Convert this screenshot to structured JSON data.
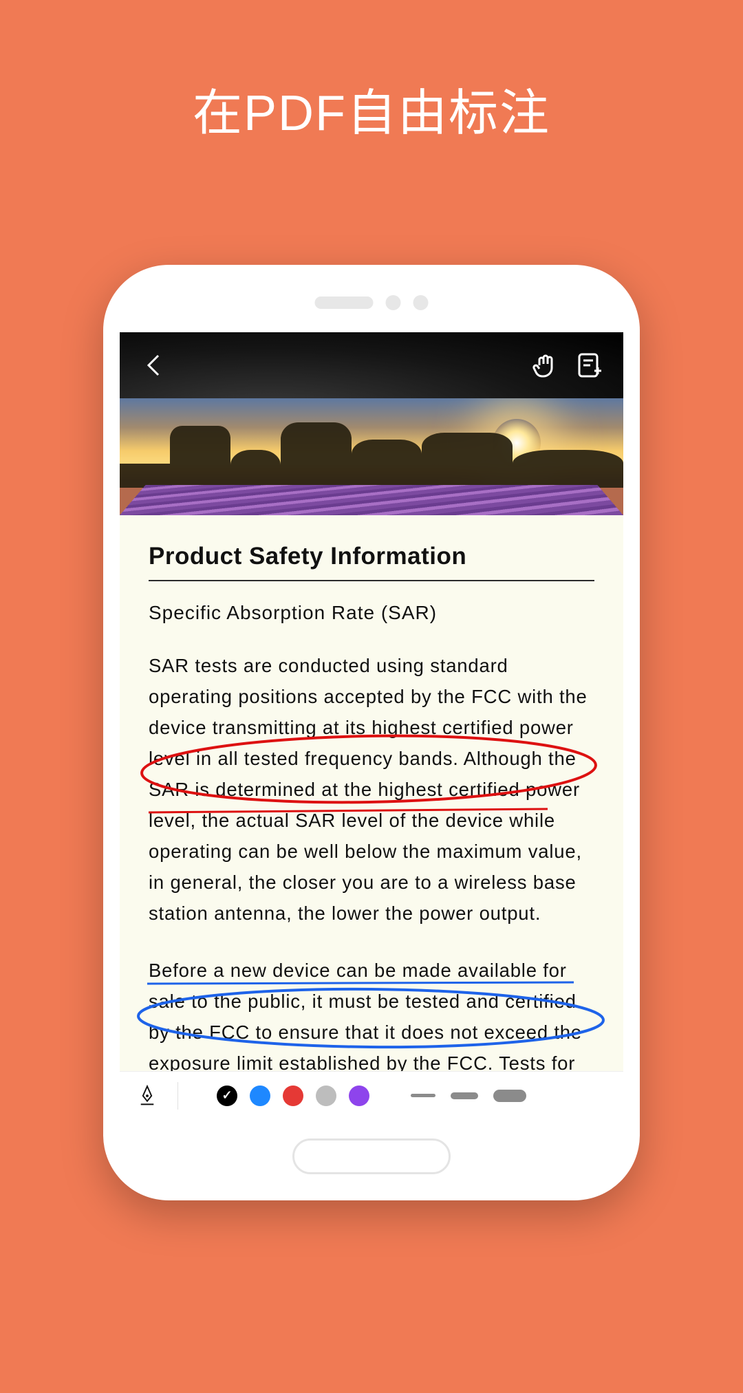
{
  "page": {
    "title": "在PDF自由标注"
  },
  "toolbar_top": {
    "back": "back",
    "hand_tool": "hand-tool",
    "add_note": "add-note"
  },
  "document": {
    "title": "Product Safety Information",
    "subtitle": "Specific Absorption Rate (SAR)",
    "para1": "SAR tests are conducted using standard operating positions accepted by the FCC with the device transmitting at its highest certified power level in all tested frequency bands. Although the SAR is determined at the highest certified power level, the actual SAR level of the device while operating can be well below the maximum value, in general, the closer you are to a wireless base station antenna, the lower the power output.",
    "para2": "Before a new device can be made available for sale to the public, it must be tested and certified by the FCC to ensure that it does not exceed the exposure limit established by the FCC. Tests for each device are performed in positions and locations as required by the FCC."
  },
  "annotation_toolbar": {
    "tool": "pen",
    "colors": [
      {
        "name": "black",
        "hex": "#000000",
        "selected": true
      },
      {
        "name": "blue",
        "hex": "#1E88FF",
        "selected": false
      },
      {
        "name": "red",
        "hex": "#E53935",
        "selected": false
      },
      {
        "name": "gray",
        "hex": "#BDBDBD",
        "selected": false
      },
      {
        "name": "purple",
        "hex": "#8E44EC",
        "selected": false
      }
    ],
    "stroke_sizes": [
      "thin",
      "medium",
      "thick"
    ]
  },
  "annotations": [
    {
      "shape": "ellipse",
      "color": "red",
      "around_text": "certified power level in all tested frequency bands. Although the SAR is determined at"
    },
    {
      "shape": "ellipse",
      "color": "red",
      "style": "strike",
      "around_text": "the highest certified power level, the actual"
    },
    {
      "shape": "ellipse",
      "color": "blue",
      "around_text": "for sale to the public, it must be tested and certified by the FCC to ensure that it does not"
    },
    {
      "shape": "underline",
      "color": "blue",
      "around_text": "Before a new device can be made available"
    }
  ]
}
